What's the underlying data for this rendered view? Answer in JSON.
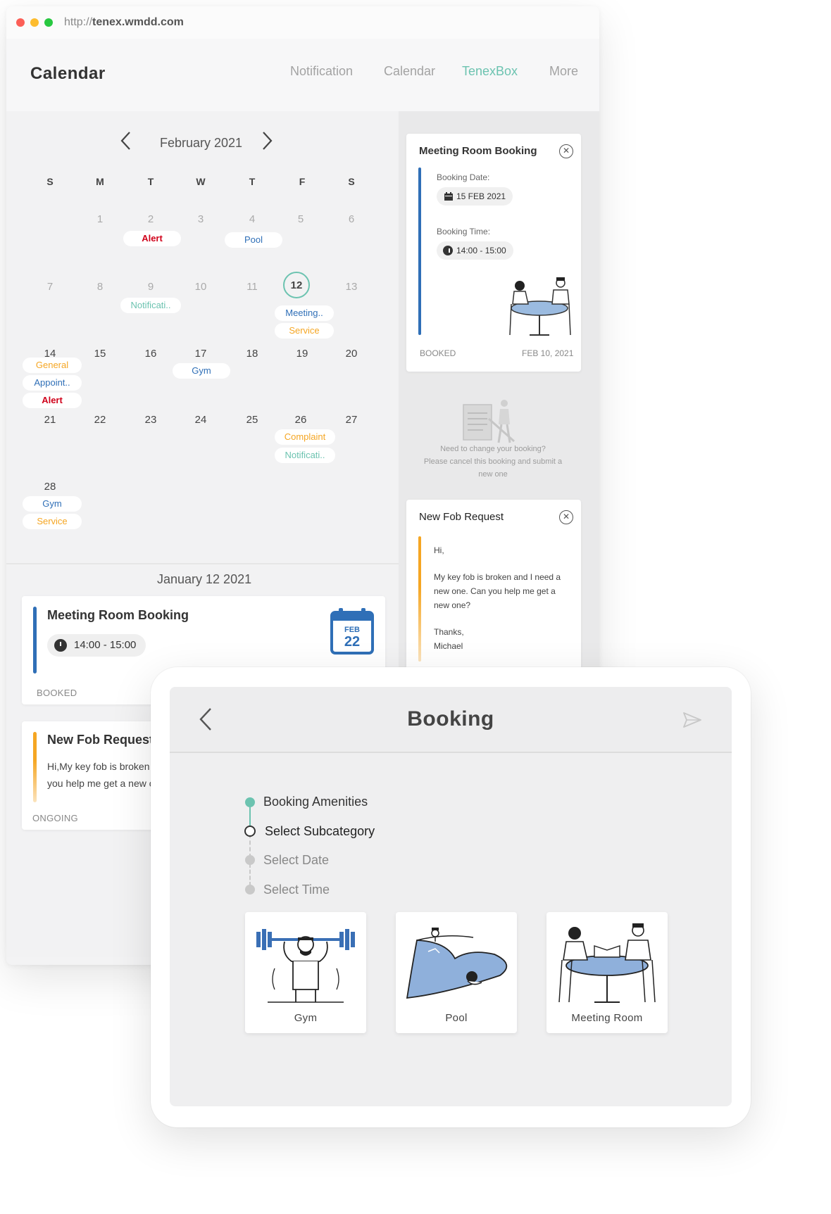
{
  "browser": {
    "url_prefix": "http://",
    "url_host": "tenex.wmdd.com"
  },
  "header": {
    "title": "Calendar",
    "nav": [
      "Notification",
      "Calendar",
      "TenexBox",
      "More"
    ],
    "active_nav": "TenexBox"
  },
  "calendar": {
    "month": "February 2021",
    "weekdays": [
      "S",
      "M",
      "T",
      "W",
      "T",
      "F",
      "S"
    ],
    "days": [
      "1",
      "2",
      "3",
      "4",
      "5",
      "6",
      "7",
      "8",
      "9",
      "10",
      "11",
      "12",
      "13",
      "14",
      "15",
      "16",
      "17",
      "18",
      "19",
      "20",
      "21",
      "22",
      "23",
      "24",
      "25",
      "26",
      "27",
      "28"
    ],
    "today": "12",
    "events": [
      {
        "day": "2",
        "label": "Alert",
        "kind": "alert"
      },
      {
        "day": "4",
        "label": "Pool",
        "kind": "blue"
      },
      {
        "day": "9",
        "label": "Notificati..",
        "kind": "teal"
      },
      {
        "day": "12",
        "label": "Meeting..",
        "kind": "blue"
      },
      {
        "day": "12",
        "label": "Service",
        "kind": "orange"
      },
      {
        "day": "14",
        "label": "General",
        "kind": "orange"
      },
      {
        "day": "14",
        "label": "Appoint..",
        "kind": "blue"
      },
      {
        "day": "14",
        "label": "Alert",
        "kind": "alert"
      },
      {
        "day": "17",
        "label": "Gym",
        "kind": "blue"
      },
      {
        "day": "26",
        "label": "Complaint",
        "kind": "orange"
      },
      {
        "day": "26",
        "label": "Notificati..",
        "kind": "teal"
      },
      {
        "day": "28",
        "label": "Gym",
        "kind": "blue"
      },
      {
        "day": "28",
        "label": "Service",
        "kind": "orange"
      }
    ]
  },
  "list": {
    "date": "January 12 2021",
    "cards": [
      {
        "title": "Meeting Room Booking",
        "time": "14:00 - 15:00",
        "status": "BOOKED",
        "badge_month": "FEB",
        "badge_day": "22"
      },
      {
        "title": "New Fob Request",
        "line1": "Hi,My key fob is broken and I need a new one. Can",
        "line2": "you help me get a new one?",
        "status": "ONGOING"
      }
    ]
  },
  "detail": {
    "booking": {
      "title": "Meeting Room Booking",
      "date_label": "Booking Date:",
      "date_value": "15 FEB 2021",
      "time_label": "Booking Time:",
      "time_value": "14:00 - 15:00",
      "status": "BOOKED",
      "created": "FEB 10, 2021",
      "close": "✕"
    },
    "help": {
      "line1": "Need to change your booking?",
      "line2": "Please cancel this booking and submit a",
      "line3": "new one"
    },
    "fob": {
      "title": "New Fob Request",
      "close": "✕",
      "greeting": "Hi,",
      "body1": "My key fob is broken and I need a",
      "body2": "new one. Can you help me get a",
      "body3": "new one?",
      "sign1": "Thanks,",
      "sign2": "Michael"
    }
  },
  "tablet": {
    "title": "Booking",
    "steps": [
      "Booking Amenities",
      "Select Subcategory",
      "Select Date",
      "Select Time"
    ],
    "options": [
      "Gym",
      "Pool",
      "Meeting Room"
    ]
  },
  "colors": {
    "accent_teal": "#6cc3b0",
    "brand_blue": "#2f6fb7",
    "warning_orange": "#f5a623",
    "alert_red": "#d0021b"
  }
}
